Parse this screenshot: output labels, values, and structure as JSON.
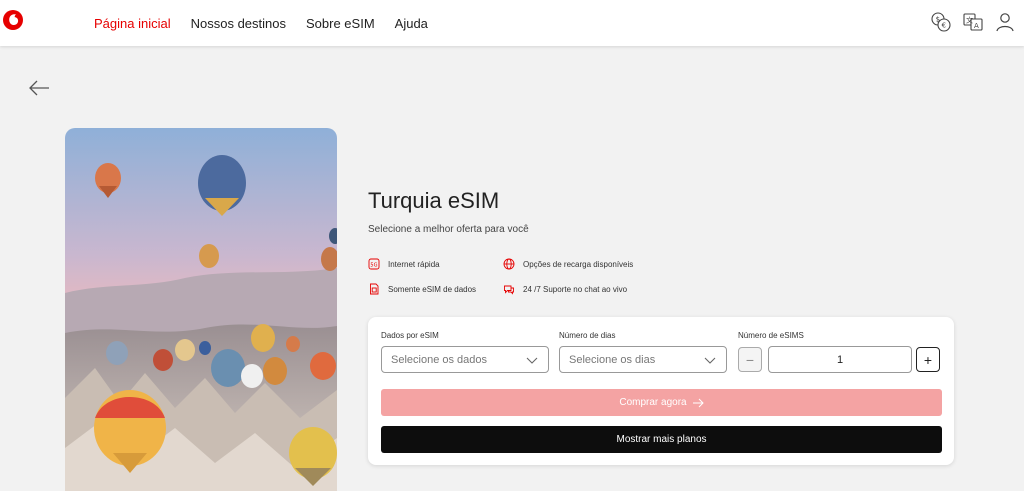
{
  "nav": {
    "items": [
      {
        "label": "Página inicial",
        "active": true
      },
      {
        "label": "Nossos destinos",
        "active": false
      },
      {
        "label": "Sobre eSIM",
        "active": false
      },
      {
        "label": "Ajuda",
        "active": false
      }
    ],
    "icons": [
      "currency-icon",
      "translate-icon",
      "user-icon"
    ]
  },
  "colors": {
    "brand": "#e60000",
    "buy_button": "#f4a3a3",
    "more_button": "#0d0d0d"
  },
  "product": {
    "title": "Turquia eSIM",
    "subtitle": "Selecione a melhor oferta para você",
    "features": [
      {
        "icon": "5g-icon",
        "label": "Internet rápida"
      },
      {
        "icon": "globe-icon",
        "label": "Opções de recarga disponíveis"
      },
      {
        "icon": "sim-card-icon",
        "label": "Somente eSIM de dados"
      },
      {
        "icon": "chat-icon",
        "label": "24 /7 Suporte no chat ao vivo"
      }
    ]
  },
  "form": {
    "data_label": "Dados por eSIM",
    "data_placeholder": "Selecione os dados",
    "days_label": "Número de dias",
    "days_placeholder": "Selecione os dias",
    "count_label": "Número de eSIMS",
    "count_value": "1",
    "minus_symbol": "−",
    "plus_symbol": "+",
    "buy_label": "Comprar agora",
    "more_label": "Mostrar mais planos"
  }
}
